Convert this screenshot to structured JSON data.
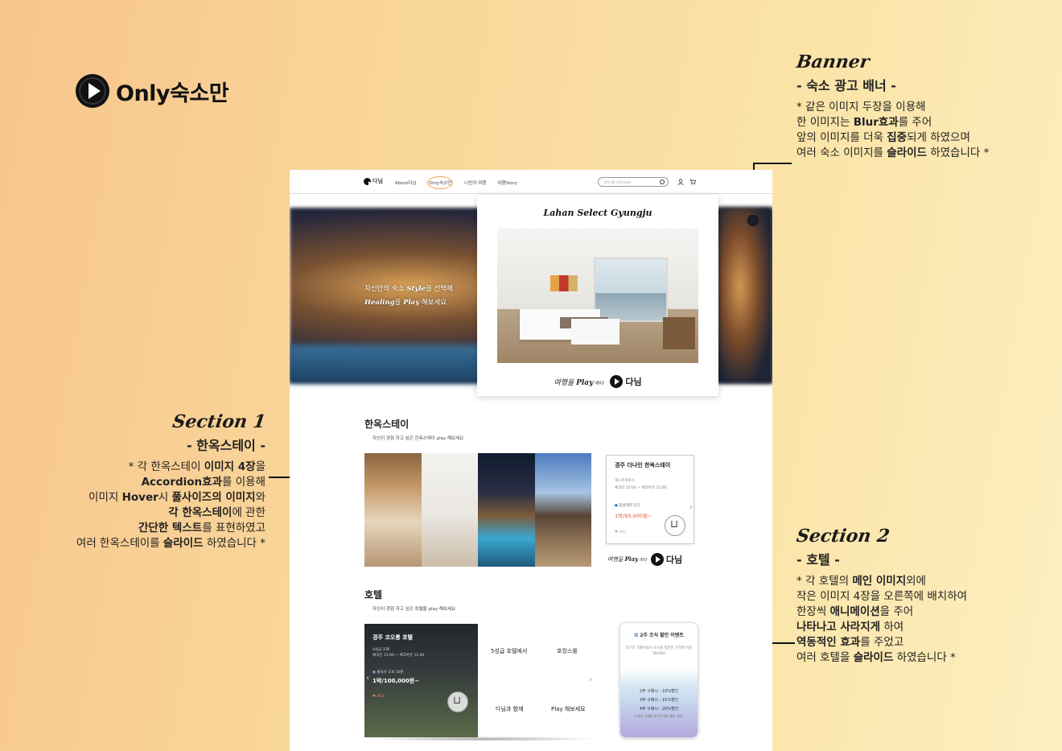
{
  "brand": {
    "name": "Only숙소만"
  },
  "banner_note": {
    "script": "Banner",
    "subtitle": "- 숙소 광고 배너 -",
    "l1a": "* 같은 이미지 두장을 이용해",
    "l2a": "한 이미지는 ",
    "l2b": "Blur효과",
    "l2c": "를 주어",
    "l3a": "앞의 이미지를 더욱 ",
    "l3b": "집중",
    "l3c": "되게 하였으며",
    "l4a": "여러 숙소 이미지를 ",
    "l4b": "슬라이드",
    "l4c": " 하였습니다 *"
  },
  "section1_note": {
    "script": "Section 1",
    "subtitle": "- 한옥스테이 -",
    "l1a": "* 각 한옥스테이 ",
    "l1b": "이미지 4장",
    "l1c": "을",
    "l2a": "Accordion효과",
    "l2b": "를 이용해",
    "l3a": "이미지 ",
    "l3b": "Hover",
    "l3c": "시 ",
    "l3d": "풀사이즈의 이미지",
    "l3e": "와",
    "l4a": "각 한옥스테이",
    "l4b": "에 관한",
    "l5a": "간단한 텍스트",
    "l5b": "를 표현하였고",
    "l6a": "여러 한옥스테이를 ",
    "l6b": "슬라이드",
    "l6c": " 하였습니다 *"
  },
  "section2_note": {
    "script": "Section 2",
    "subtitle": "- 호텔 -",
    "l1a": "* 각 호텔의 ",
    "l1b": "메인 이미지",
    "l1c": "외에",
    "l2": "작은 이미지 4장을 오른쪽에 배치하여",
    "l3a": "한장씩 ",
    "l3b": "애니메이션",
    "l3c": "을 주어",
    "l4a": "나타나고 사라지게",
    "l4b": " 하여",
    "l5a": "역동적인 효과",
    "l5b": "를 주었고",
    "l6a": "여러 호텔을 ",
    "l6b": "슬라이드",
    "l6c": " 하였습니다 *"
  },
  "site": {
    "nav": {
      "logo": "다님",
      "menu": [
        "About다님",
        "Only숙소만",
        "나만의 여행",
        "여행Story"
      ],
      "search_placeholder": "검색어를 입력하세요"
    },
    "banner": {
      "line1a": "자신만의 숙소 ",
      "line1b": "Style",
      "line1c": "을 선택해",
      "line2a": "Healing",
      "line2b": "을 ",
      "line2c": "Play",
      "line2d": " 해보세요",
      "card_title": "Lahan Select Gyungju",
      "foot_a": "여행을 ",
      "foot_b": "Play",
      "foot_c": " 하다",
      "foot_logo": "다님"
    },
    "hanok": {
      "title": "한옥스테이",
      "subtitle": "자신이 경험 하고 싶은 한옥스테이 play 해보세요",
      "card_title": "경주 더나인 한옥스테이",
      "card_type": "게스트하우스",
      "card_time": "체크인 15:00 ~ 체크아웃 11:00",
      "card_loc": "첨성대역 인근",
      "card_price": "1박/95,000원~",
      "card_likes": "♥ 463",
      "foot_a": "여행을 ",
      "foot_b": "Play",
      "foot_c": " 하다",
      "foot_logo": "다님"
    },
    "hotel": {
      "title": "호텔",
      "subtitle": "자신이 경험 하고 싶은 호텔을 play 해보세요",
      "card_title": "경주 코오롱 호텔",
      "card_grade": "4성급 호텔",
      "card_time": "체크인 15:00 ~ 체크아웃 11:00",
      "card_loc": "불국사 도보 10분",
      "card_price": "1박/100,000원~",
      "card_likes": "♥ 453",
      "grid": [
        "5성급 호텔에서",
        "호캉스를",
        "다님과 함께",
        "Play 해보세요"
      ],
      "event_title": "2주 조식 할인 이벤트",
      "event_desc": "장기간 호텔이용시 조식을 할인된 가격에 이용해보세요",
      "event_list": [
        "2주 구매시 : 10%할인",
        "3주 구매시 : 15%할인",
        "4주 구매시 : 20%할인"
      ],
      "event_note": "(1주당 구매한 관 주식세트 할인 기준)"
    }
  }
}
